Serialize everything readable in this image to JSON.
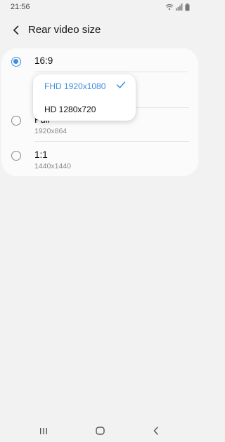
{
  "status_bar": {
    "time": "21:56"
  },
  "header": {
    "title": "Rear video size"
  },
  "options": [
    {
      "label": "16:9",
      "sub": ""
    },
    {
      "label": "Full",
      "sub": "1920x864"
    },
    {
      "label": "1:1",
      "sub": "1440x1440"
    }
  ],
  "popup": {
    "items": [
      {
        "label": "FHD 1920x1080"
      },
      {
        "label": "HD 1280x720"
      }
    ]
  },
  "colors": {
    "accent": "#3e8ee4",
    "background": "#f2f2f2",
    "card": "#fbfbfb"
  },
  "icons": {
    "back": "chevron-left-icon",
    "check": "check-icon",
    "recents": "recents-icon",
    "home": "home-icon",
    "nav_back": "nav-back-icon"
  }
}
